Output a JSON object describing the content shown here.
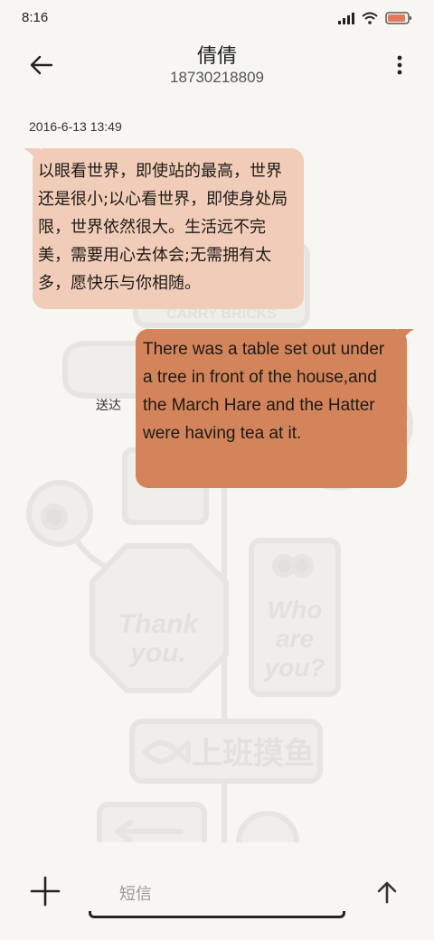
{
  "status_bar": {
    "time": "8:16",
    "icons": [
      "signal-icon",
      "wifi-icon",
      "battery-icon"
    ]
  },
  "header": {
    "contact_name": "倩倩",
    "contact_number": "18730218809",
    "back_icon": "arrow-left-icon",
    "more_icon": "more-vertical-icon"
  },
  "conversation": {
    "timestamp": "2016-6-13 13:49",
    "messages": [
      {
        "direction": "incoming",
        "text": "以眼看世界，即使站的最高，世界还是很小;以心看世界，即使身处局限，世界依然很大。生活远不完美，需要用心去体会;无需拥有太多，愿快乐与你相随。"
      },
      {
        "direction": "outgoing",
        "text": "There was a table set out under a tree in front of the house,and the March Hare and the Hatter were having tea at it.",
        "status": "送达"
      }
    ]
  },
  "wallpaper": {
    "sign_1": "Thank you.",
    "sign_2": "Who are you?",
    "sign_3": "上班摸鱼",
    "sign_4": "CARRY BRICKS"
  },
  "input_bar": {
    "placeholder": "短信",
    "add_icon": "plus-icon",
    "send_icon": "arrow-up-icon"
  },
  "colors": {
    "incoming_bubble": "#f1cdb9",
    "outgoing_bubble": "#d4845a",
    "background": "#f7f6f3"
  }
}
